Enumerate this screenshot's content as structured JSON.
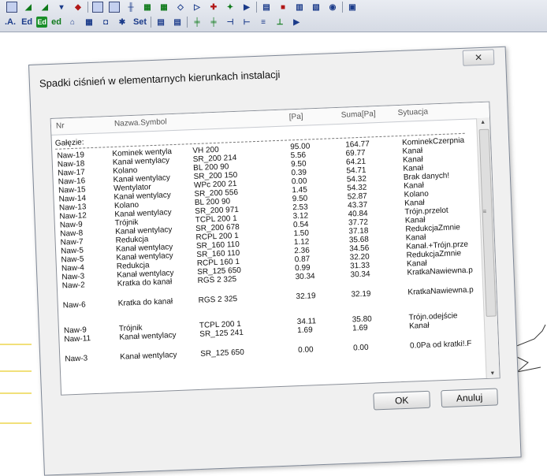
{
  "toolbar": {
    "row2_labels": [
      "Ed",
      "Ed",
      "ed",
      "Set"
    ]
  },
  "dialog": {
    "title": "Spadki ciśnień w elementarnych kierunkach instalacji",
    "close_icon": "✕",
    "columns": [
      "Nr",
      "Nazwa.Symbol",
      "[Pa]",
      "Suma[Pa]",
      "Sytuacja"
    ],
    "section_label": "Gałęzie:",
    "rows": [
      {
        "nr": "Naw-19",
        "nazwa": "Kominek wentyla",
        "symbol": "VH 200",
        "pa": "95.00",
        "suma": "164.77",
        "sytuacja": "KominekCzerpnia"
      },
      {
        "nr": "Naw-18",
        "nazwa": "Kanał wentylacy",
        "symbol": "SR_200 214",
        "pa": "5.56",
        "suma": "69.77",
        "sytuacja": "Kanał"
      },
      {
        "nr": "Naw-17",
        "nazwa": "Kolano",
        "symbol": "BL 200 90",
        "pa": "9.50",
        "suma": "64.21",
        "sytuacja": "Kanał"
      },
      {
        "nr": "Naw-16",
        "nazwa": "Kanał wentylacy",
        "symbol": "SR_200 150",
        "pa": "0.39",
        "suma": "54.71",
        "sytuacja": "Kanał"
      },
      {
        "nr": "Naw-15",
        "nazwa": "Wentylator",
        "symbol": "WPc 200 21",
        "pa": "0.00",
        "suma": "54.32",
        "sytuacja": "Brak danych!"
      },
      {
        "nr": "Naw-14",
        "nazwa": "Kanał wentylacy",
        "symbol": "SR_200 556",
        "pa": "1.45",
        "suma": "54.32",
        "sytuacja": "Kanał"
      },
      {
        "nr": "Naw-13",
        "nazwa": "Kolano",
        "symbol": "BL 200 90",
        "pa": "9.50",
        "suma": "52.87",
        "sytuacja": "Kolano"
      },
      {
        "nr": "Naw-12",
        "nazwa": "Kanał wentylacy",
        "symbol": "SR_200 971",
        "pa": "2.53",
        "suma": "43.37",
        "sytuacja": "Kanał"
      },
      {
        "nr": "Naw-9",
        "nazwa": "Trójnik",
        "symbol": "TCPL 200 1",
        "pa": "3.12",
        "suma": "40.84",
        "sytuacja": "Trójn.przelot"
      },
      {
        "nr": "Naw-8",
        "nazwa": "Kanał wentylacy",
        "symbol": "SR_200 678",
        "pa": "0.54",
        "suma": "37.72",
        "sytuacja": "Kanał"
      },
      {
        "nr": "Naw-7",
        "nazwa": "Redukcja",
        "symbol": "RCPL 200 1",
        "pa": "1.50",
        "suma": "37.18",
        "sytuacja": "RedukcjaZmnie"
      },
      {
        "nr": "Naw-5",
        "nazwa": "Kanał wentylacy",
        "symbol": "SR_160 110",
        "pa": "1.12",
        "suma": "35.68",
        "sytuacja": "Kanał"
      },
      {
        "nr": "Naw-5",
        "nazwa": "Kanał wentylacy",
        "symbol": "SR_160 110",
        "pa": "2.36",
        "suma": "34.56",
        "sytuacja": "Kanał.+Trójn.prze"
      },
      {
        "nr": "Naw-4",
        "nazwa": "Redukcja",
        "symbol": "RCPL 160 1",
        "pa": "0.87",
        "suma": "32.20",
        "sytuacja": "RedukcjaZmnie"
      },
      {
        "nr": "Naw-3",
        "nazwa": "Kanał wentylacy",
        "symbol": "SR_125 650",
        "pa": "0.99",
        "suma": "31.33",
        "sytuacja": "Kanał"
      },
      {
        "nr": "Naw-2",
        "nazwa": "Kratka do kanał",
        "symbol": "RGS 2 325",
        "pa": "30.34",
        "suma": "30.34",
        "sytuacja": "KratkaNawiewna.p"
      },
      {
        "nr": "Naw-6",
        "nazwa": "Kratka do kanał",
        "symbol": "RGS 2 325",
        "pa": "32.19",
        "suma": "32.19",
        "sytuacja": "KratkaNawiewna.p"
      },
      {
        "nr": "Naw-9",
        "nazwa": "Trójnik",
        "symbol": "TCPL 200 1",
        "pa": "34.11",
        "suma": "35.80",
        "sytuacja": "Trójn.odejście"
      },
      {
        "nr": "Naw-11",
        "nazwa": "Kanał wentylacy",
        "symbol": "SR_125 241",
        "pa": "1.69",
        "suma": "1.69",
        "sytuacja": "Kanał"
      },
      {
        "nr": "Naw-3",
        "nazwa": "Kanał wentylacy",
        "symbol": "SR_125 650",
        "pa": "0.00",
        "suma": "0.00",
        "sytuacja": "0.0Pa od kratki!.F"
      }
    ],
    "ok_label": "OK",
    "cancel_label": "Anuluj"
  }
}
